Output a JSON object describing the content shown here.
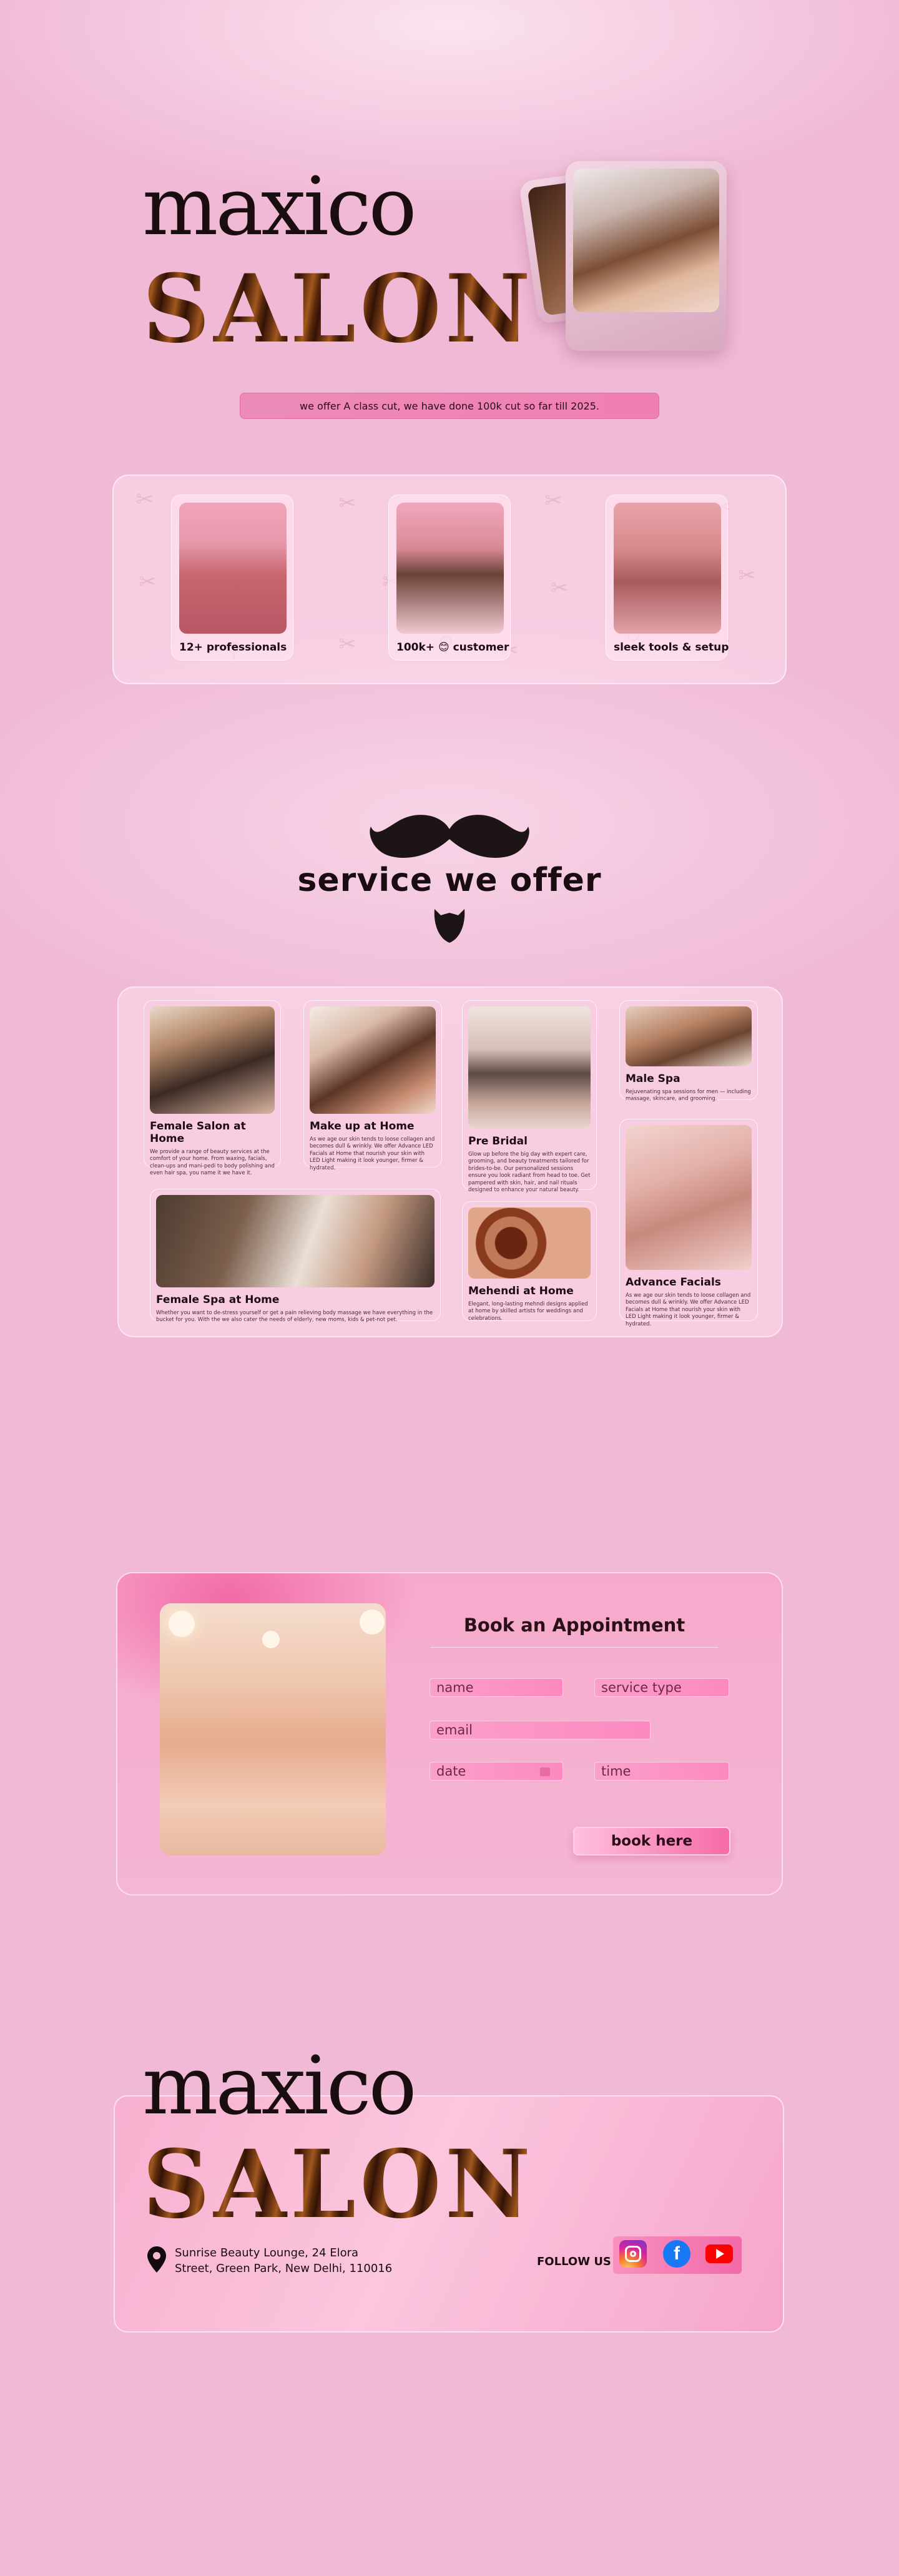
{
  "brand": {
    "line1": "maxico",
    "line2": "SALON"
  },
  "tagline": "we offer A class cut, we have done 100k cut so far till 2025.",
  "stats": [
    {
      "label": "12+ professionals"
    },
    {
      "label": "100k+ 😊 customer"
    },
    {
      "label": "sleek tools & setup"
    }
  ],
  "services_title": "service we offer",
  "services": {
    "female_salon": {
      "title": "Female Salon at Home",
      "desc": "We provide a range of beauty services at the comfort of your home. From waxing, facials, clean-ups and mani-pedi to body polishing and even hair spa, you name it we have it."
    },
    "makeup": {
      "title": "Make up at Home",
      "desc": "As we age our skin tends to loose collagen and becomes dull & wrinkly. We offer Advance LED Facials at Home that nourish your skin with LED Light making it look younger, firmer & hydrated."
    },
    "pre_bridal": {
      "title": "Pre Bridal",
      "desc": "Glow up before the big day with expert care, grooming, and beauty treatments tailored for brides-to-be. Our personalized sessions ensure you look radiant from head to toe. Get pampered with skin, hair, and nail rituals designed to enhance your natural beauty."
    },
    "male_spa": {
      "title": "Male Spa",
      "desc": "Rejuvenating spa sessions for men — including massage, skincare, and grooming."
    },
    "female_spa": {
      "title": "Female Spa at Home",
      "desc": "Whether you want to de-stress yourself or get a pain relieving body massage we have everything in the bucket for you. With the we also cater the needs of elderly, new moms, kids & pet-not pet."
    },
    "mehendi": {
      "title": "Mehendi at Home",
      "desc": "Elegant, long-lasting mehndi designs applied at home by skilled artists for weddings and celebrations."
    },
    "facials": {
      "title": "Advance Facials",
      "desc": "As we age our skin tends to loose collagen and becomes dull & wrinkly. We offer Advance LED Facials at Home that nourish your skin with LED Light making it look younger, firmer & hydrated."
    }
  },
  "booking": {
    "title": "Book an Appointment",
    "name_placeholder": "name",
    "service_placeholder": "service type",
    "email_placeholder": "email",
    "date_placeholder": "date",
    "time_placeholder": "time",
    "button": "book here"
  },
  "footer": {
    "address_line1": "Sunrise Beauty Lounge, 24 Elora",
    "address_line2": "Street, Green Park, New Delhi, 110016",
    "follow": "FOLLOW US"
  },
  "colors": {
    "background": "#f0b9d6",
    "accent_pink": "#f07fb3",
    "brand_brown": "#6b3412",
    "text_dark": "#1a0d12"
  },
  "icons": {
    "location": "location-pin-icon",
    "instagram": "instagram-icon",
    "facebook": "facebook-icon",
    "youtube": "youtube-icon",
    "calendar": "calendar-icon",
    "mustache": "mustache-icon",
    "beard": "beard-icon"
  }
}
